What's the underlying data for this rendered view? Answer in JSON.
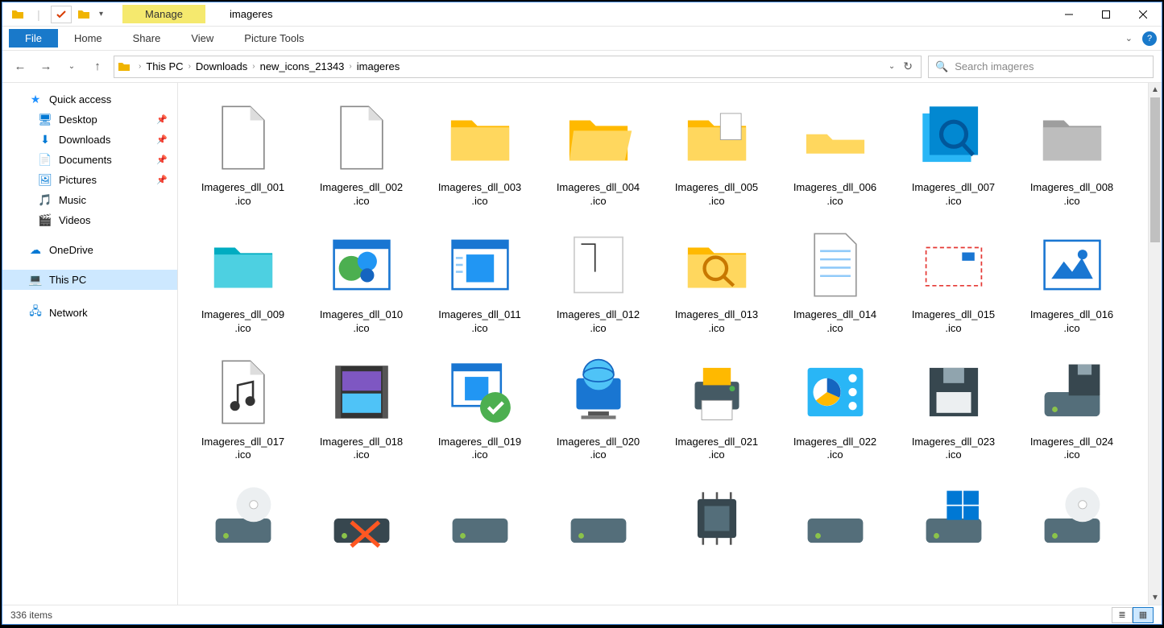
{
  "title": "imageres",
  "ribbon": {
    "manage_label": "Manage",
    "file_tab": "File",
    "tabs": [
      "Home",
      "Share",
      "View"
    ],
    "context_tab": "Picture Tools"
  },
  "breadcrumb": {
    "parts": [
      "This PC",
      "Downloads",
      "new_icons_21343",
      "imageres"
    ]
  },
  "search": {
    "placeholder": "Search imageres"
  },
  "nav_pane": {
    "quick_access": "Quick access",
    "items": [
      {
        "label": "Desktop",
        "pinned": true,
        "icon": "desktop"
      },
      {
        "label": "Downloads",
        "pinned": true,
        "icon": "downloads"
      },
      {
        "label": "Documents",
        "pinned": true,
        "icon": "documents"
      },
      {
        "label": "Pictures",
        "pinned": true,
        "icon": "pictures"
      },
      {
        "label": "Music",
        "pinned": false,
        "icon": "music"
      },
      {
        "label": "Videos",
        "pinned": false,
        "icon": "videos"
      }
    ],
    "onedrive": "OneDrive",
    "this_pc": "This PC",
    "network": "Network"
  },
  "files": [
    {
      "name": "Imageres_dll_001.ico",
      "icon": "file-blank"
    },
    {
      "name": "Imageres_dll_002.ico",
      "icon": "file-blank"
    },
    {
      "name": "Imageres_dll_003.ico",
      "icon": "folder-closed"
    },
    {
      "name": "Imageres_dll_004.ico",
      "icon": "folder-open"
    },
    {
      "name": "Imageres_dll_005.ico",
      "icon": "folder-docs"
    },
    {
      "name": "Imageres_dll_006.ico",
      "icon": "folder-empty"
    },
    {
      "name": "Imageres_dll_007.ico",
      "icon": "folder-search"
    },
    {
      "name": "Imageres_dll_008.ico",
      "icon": "folder-gray"
    },
    {
      "name": "Imageres_dll_009.ico",
      "icon": "folder-blue"
    },
    {
      "name": "Imageres_dll_010.ico",
      "icon": "program-window"
    },
    {
      "name": "Imageres_dll_011.ico",
      "icon": "app-window"
    },
    {
      "name": "Imageres_dll_012.ico",
      "icon": "app-generic"
    },
    {
      "name": "Imageres_dll_013.ico",
      "icon": "folder-find"
    },
    {
      "name": "Imageres_dll_014.ico",
      "icon": "text-file"
    },
    {
      "name": "Imageres_dll_015.ico",
      "icon": "mail"
    },
    {
      "name": "Imageres_dll_016.ico",
      "icon": "picture"
    },
    {
      "name": "Imageres_dll_017.ico",
      "icon": "audio-file"
    },
    {
      "name": "Imageres_dll_018.ico",
      "icon": "video-file"
    },
    {
      "name": "Imageres_dll_019.ico",
      "icon": "program-ok"
    },
    {
      "name": "Imageres_dll_020.ico",
      "icon": "computer-net"
    },
    {
      "name": "Imageres_dll_021.ico",
      "icon": "printer"
    },
    {
      "name": "Imageres_dll_022.ico",
      "icon": "control-panel"
    },
    {
      "name": "Imageres_dll_023.ico",
      "icon": "floppy"
    },
    {
      "name": "Imageres_dll_024.ico",
      "icon": "drive-floppy"
    },
    {
      "name": "",
      "icon": "drive-cd"
    },
    {
      "name": "",
      "icon": "drive-x"
    },
    {
      "name": "",
      "icon": "drive"
    },
    {
      "name": "",
      "icon": "drive"
    },
    {
      "name": "",
      "icon": "cpu"
    },
    {
      "name": "",
      "icon": "drive"
    },
    {
      "name": "",
      "icon": "drive-win"
    },
    {
      "name": "",
      "icon": "drive-cd"
    }
  ],
  "status": {
    "item_count": "336 items"
  }
}
